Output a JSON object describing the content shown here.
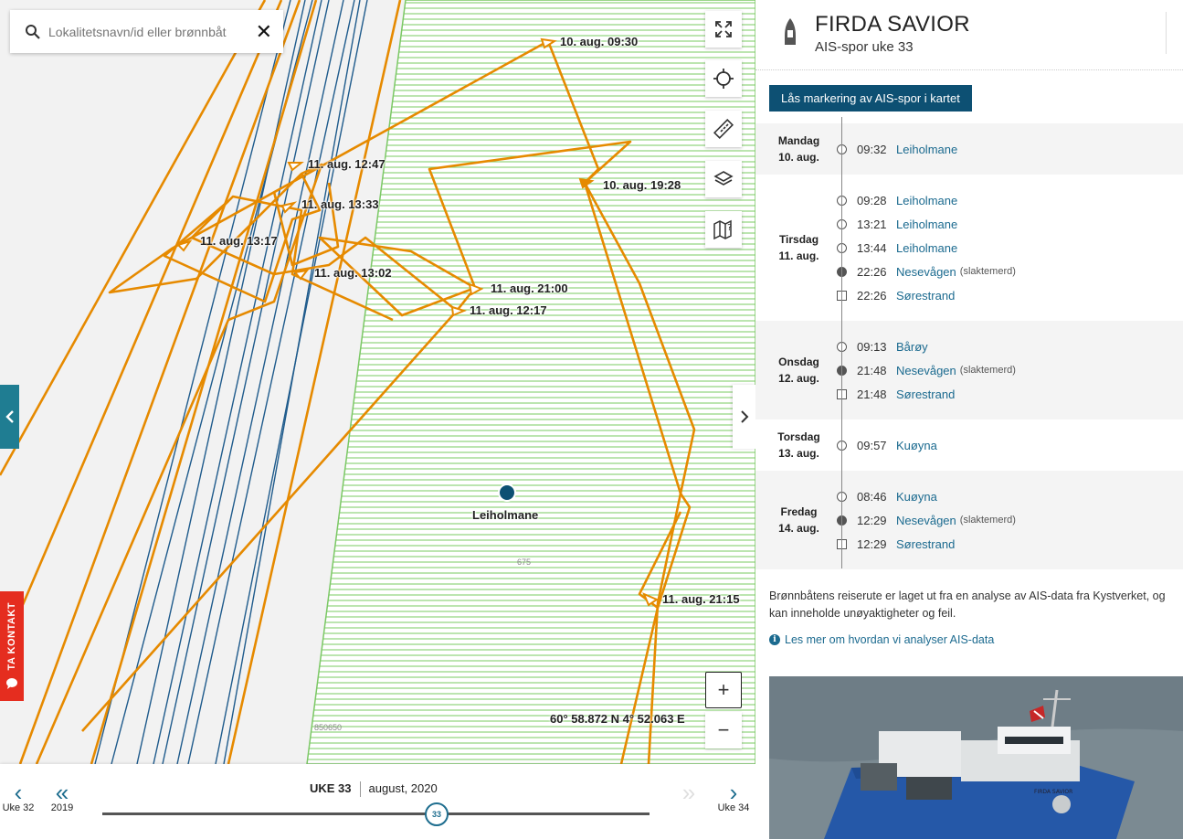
{
  "search": {
    "placeholder": "Lokalitetsnavn/id eller brønnbåt"
  },
  "map": {
    "track_labels": [
      "10. aug. 09:30",
      "10. aug. 19:28",
      "11. aug. 12:47",
      "11. aug. 13:33",
      "11. aug. 13:17",
      "11. aug. 13:02",
      "11. aug. 21:00",
      "11. aug. 12:17",
      "11. aug. 21:15"
    ],
    "site_name": "Leiholmane",
    "area_number": "675",
    "area_code": "850650",
    "coordinates": "60° 58.872 N 4° 52.063 E",
    "zoom_in": "+",
    "zoom_out": "−",
    "contact_label": "TA KONTAKT",
    "colors": {
      "track": "#e68a00",
      "shipping_lane": "#1f5b8c",
      "zone_stripe": "#8fd47a",
      "site_marker": "#0d5073"
    }
  },
  "timeline": {
    "week_label": "UKE 33",
    "month_label": "august, 2020",
    "prev_week": "Uke 32",
    "prev_year": "2019",
    "next_week": "Uke 34",
    "current_week": "33"
  },
  "panel": {
    "vessel_name": "FIRDA SAVIOR",
    "subtitle": "AIS-spor uke 33",
    "lock_button": "Lås markering av AIS-spor i kartet",
    "days": [
      {
        "weekday": "Mandag",
        "date": "10. aug.",
        "entries": [
          {
            "time": "09:32",
            "place": "Leiholmane",
            "note": "",
            "marker": "circle"
          }
        ]
      },
      {
        "weekday": "Tirsdag",
        "date": "11. aug.",
        "entries": [
          {
            "time": "09:28",
            "place": "Leiholmane",
            "note": "",
            "marker": "circle"
          },
          {
            "time": "13:21",
            "place": "Leiholmane",
            "note": "",
            "marker": "circle"
          },
          {
            "time": "13:44",
            "place": "Leiholmane",
            "note": "",
            "marker": "circle"
          },
          {
            "time": "22:26",
            "place": "Nesevågen",
            "note": "(slaktemerd)",
            "marker": "filled"
          },
          {
            "time": "22:26",
            "place": "Sørestrand",
            "note": "",
            "marker": "square"
          }
        ]
      },
      {
        "weekday": "Onsdag",
        "date": "12. aug.",
        "entries": [
          {
            "time": "09:13",
            "place": "Bårøy",
            "note": "",
            "marker": "circle"
          },
          {
            "time": "21:48",
            "place": "Nesevågen",
            "note": "(slaktemerd)",
            "marker": "filled"
          },
          {
            "time": "21:48",
            "place": "Sørestrand",
            "note": "",
            "marker": "square"
          }
        ]
      },
      {
        "weekday": "Torsdag",
        "date": "13. aug.",
        "entries": [
          {
            "time": "09:57",
            "place": "Kuøyna",
            "note": "",
            "marker": "circle"
          }
        ]
      },
      {
        "weekday": "Fredag",
        "date": "14. aug.",
        "entries": [
          {
            "time": "08:46",
            "place": "Kuøyna",
            "note": "",
            "marker": "circle"
          },
          {
            "time": "12:29",
            "place": "Nesevågen",
            "note": "(slaktemerd)",
            "marker": "filled"
          },
          {
            "time": "12:29",
            "place": "Sørestrand",
            "note": "",
            "marker": "square"
          }
        ]
      }
    ],
    "description": "Brønnbåtens reiserute er laget ut fra en analyse av AIS-data fra Kystverket, og kan inneholde unøyaktigheter og feil.",
    "more_link": "Les mer om hvordan vi analyser AIS-data",
    "photo_ship_name": "FIRDA SAVIOR"
  }
}
